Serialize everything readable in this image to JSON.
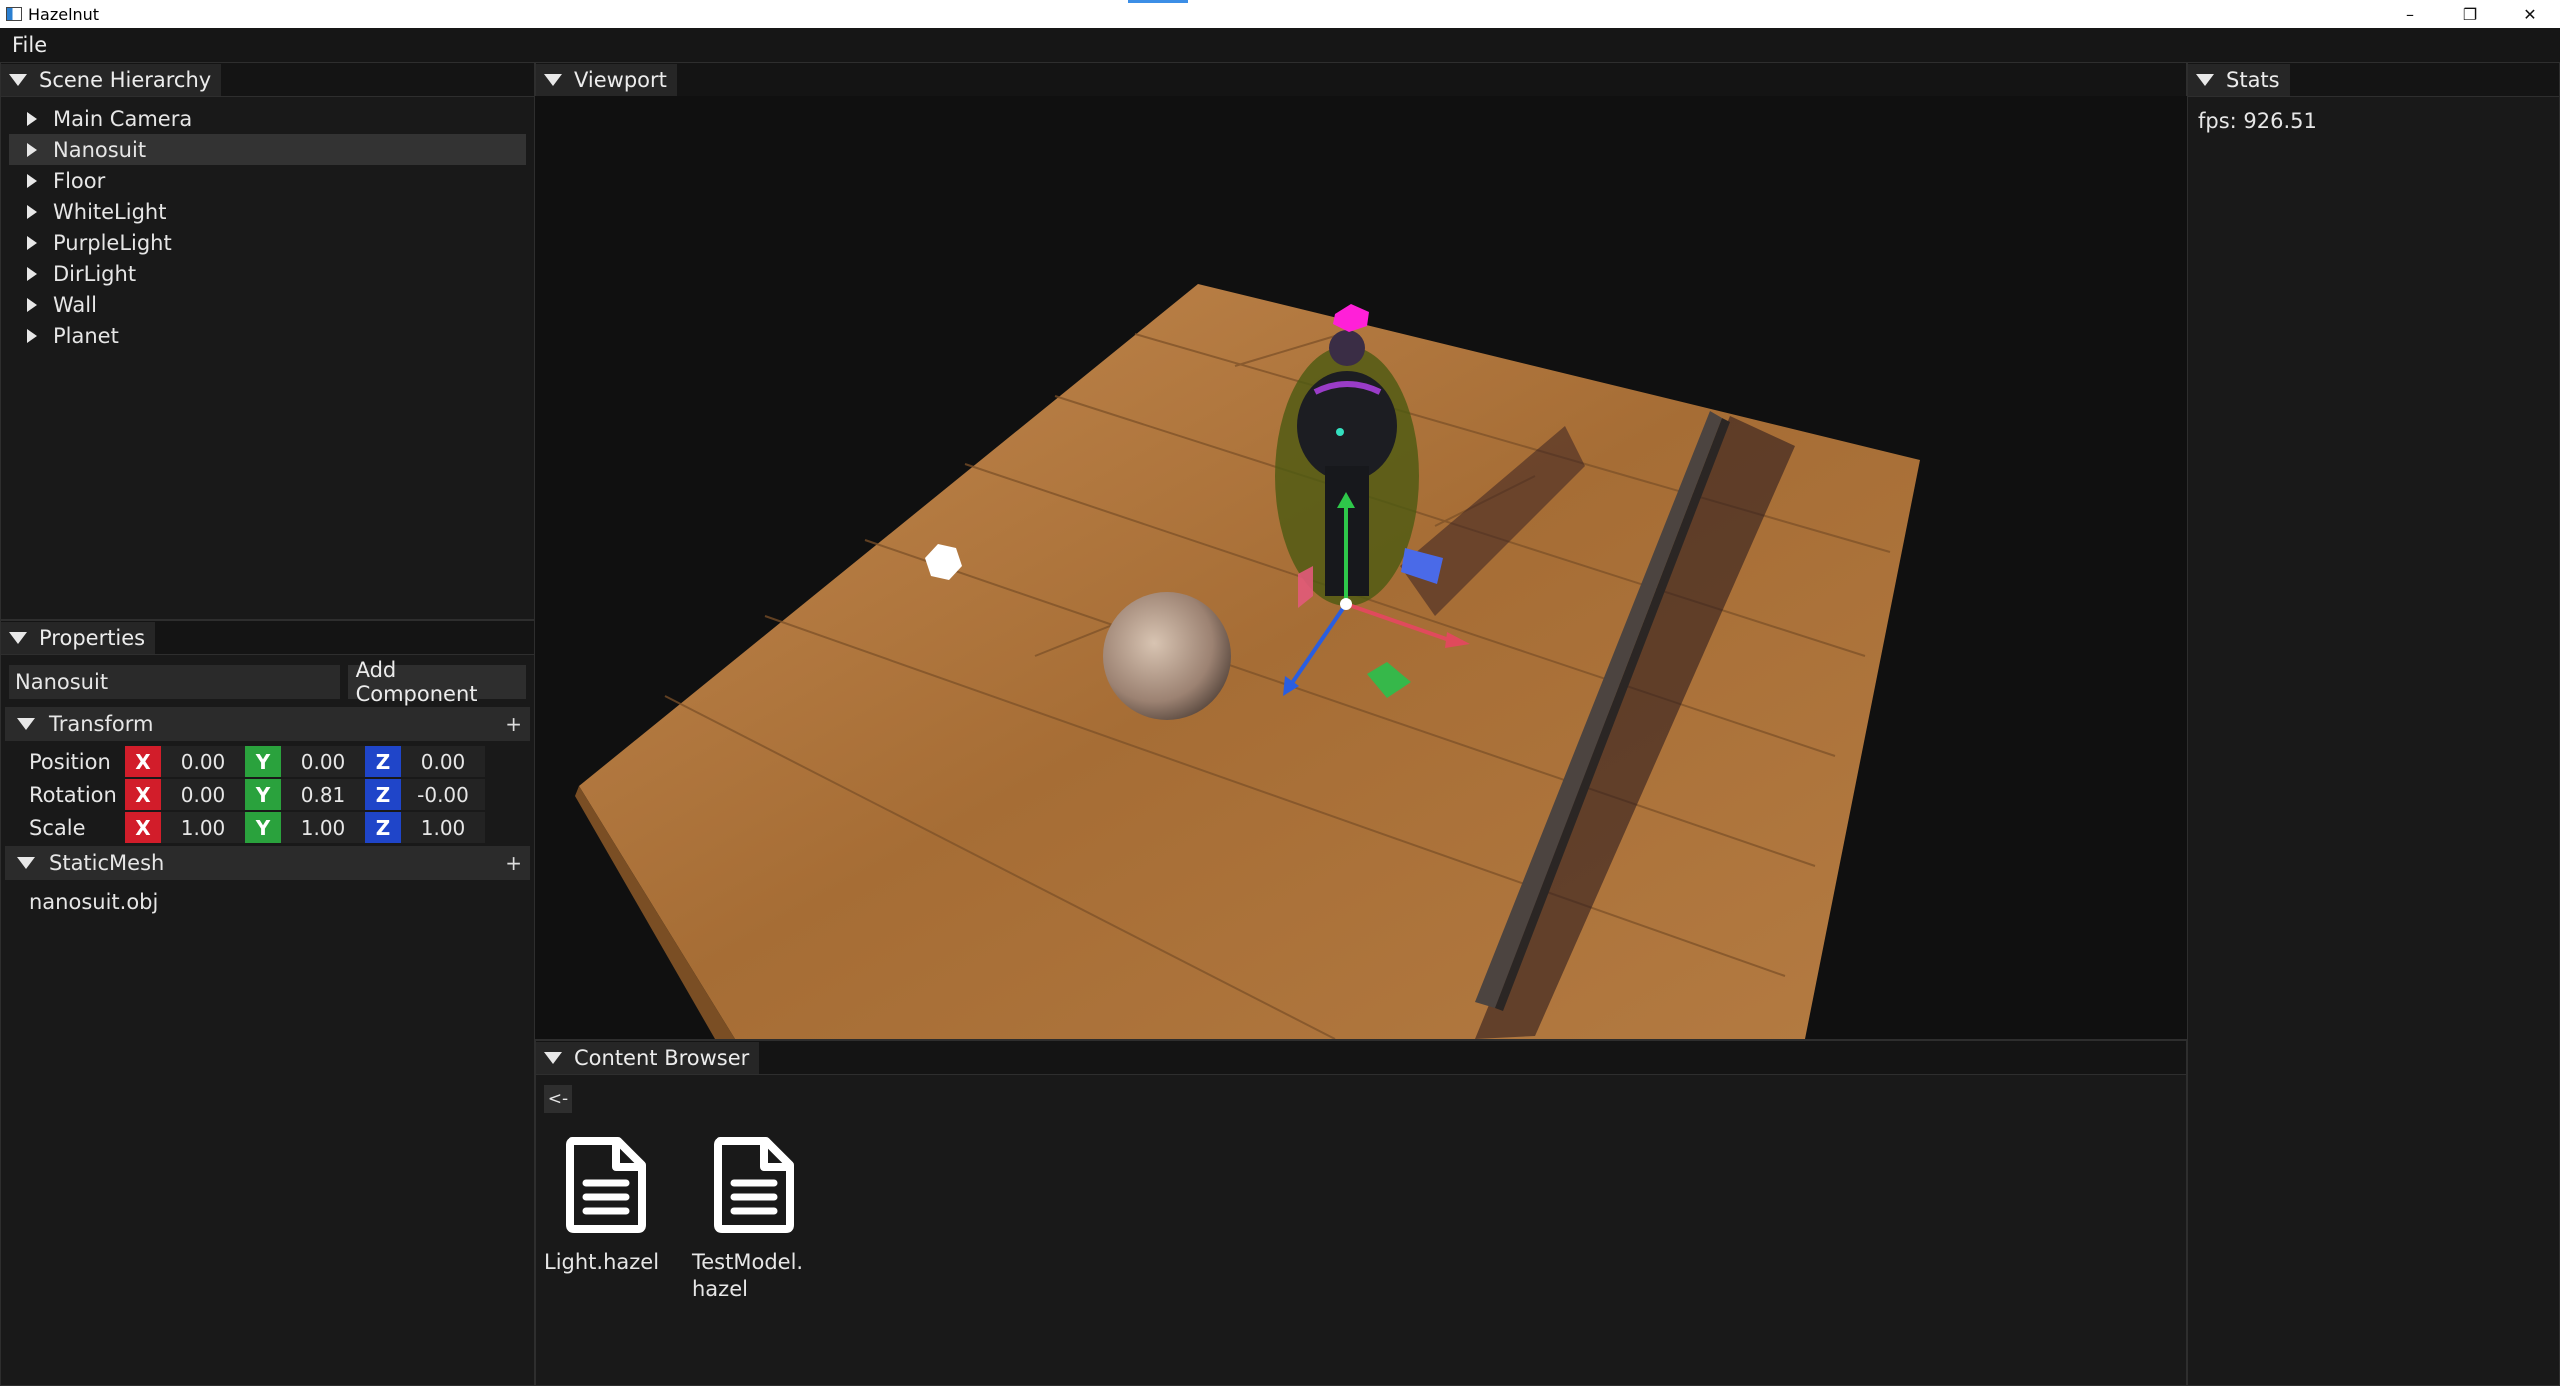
{
  "window": {
    "title": "Hazelnut",
    "buttons": {
      "minimize": "–",
      "restore": "❐",
      "close": "✕"
    }
  },
  "menubar": {
    "items": [
      "File"
    ]
  },
  "scene_hierarchy": {
    "title": "Scene Hierarchy",
    "items": [
      "Main Camera",
      "Nanosuit",
      "Floor",
      "WhiteLight",
      "PurpleLight",
      "DirLight",
      "Wall",
      "Planet"
    ],
    "selected": "Nanosuit"
  },
  "properties": {
    "title": "Properties",
    "entity_name": "Nanosuit",
    "add_component_label": "Add Component",
    "transform": {
      "title": "Transform",
      "add_label": "+",
      "rows": [
        {
          "label": "Position",
          "x": "0.00",
          "y": "0.00",
          "z": "0.00"
        },
        {
          "label": "Rotation",
          "x": "0.00",
          "y": "0.81",
          "z": "-0.00"
        },
        {
          "label": "Scale",
          "x": "1.00",
          "y": "1.00",
          "z": "1.00"
        }
      ],
      "axis_labels": {
        "x": "X",
        "y": "Y",
        "z": "Z"
      },
      "axis_colors": {
        "x": "#d21d2a",
        "y": "#2aa23d",
        "z": "#1f45c9"
      }
    },
    "static_mesh": {
      "title": "StaticMesh",
      "add_label": "+",
      "file": "nanosuit.obj"
    }
  },
  "viewport": {
    "title": "Viewport"
  },
  "content_browser": {
    "title": "Content Browser",
    "back_label": "<-",
    "files": [
      {
        "name": "Light.hazel",
        "icon": "file-document-icon"
      },
      {
        "name": "TestModel.\nhazel",
        "icon": "file-document-icon"
      }
    ]
  },
  "stats": {
    "title": "Stats",
    "fps_text": "fps: 926.51"
  }
}
